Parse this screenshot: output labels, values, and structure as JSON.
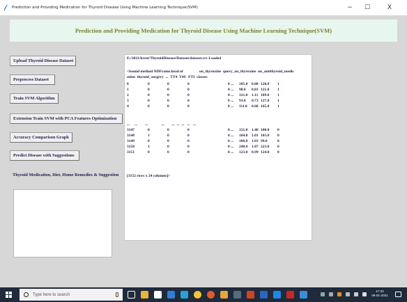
{
  "window": {
    "title": "Prediction and Providing Medication for Thyroid Disease Using Machine Learning Technique(SVM)",
    "minimize": "−",
    "maximize": "☐",
    "close": "X"
  },
  "header": {
    "title": "Prediction and Providing Medication for Thyroid Disease Using Machine Learning Technique(SVM)",
    "colors": {
      "background": "#e7f6ee",
      "text": "#7b7f2c"
    }
  },
  "buttons": [
    {
      "name": "upload-dataset-button",
      "label": "Upload Thyroid Disease Dataset"
    },
    {
      "name": "preprocess-dataset-button",
      "label": "Preprocess Dataset"
    },
    {
      "name": "train-svm-button",
      "label": "Train SVM Algorithm"
    },
    {
      "name": "extension-train-svm-pca-button",
      "label": "Extension Train SVM with PCA Features Optimization"
    },
    {
      "name": "accuracy-comparison-graph-button",
      "label": "Accuracy Comparison Graph"
    },
    {
      "name": "predict-disease-button",
      "label": "Predict Disease with Suggestions"
    },
    {
      "name": "thyroid-medication-button",
      "label": "Thyroid Medication, Diet, Home Remedies & Suggestion"
    }
  ],
  "output": {
    "loaded_message": "E:/2021/kreet/ThyroidDisease/Dataset/dataset.csv Loaded",
    "header_line1": "<bound method NDFrame.head of",
    "header_line1_cols": "on_thyroxine  query_on_thyroxine  on_antithyroid_medic",
    "header_line2": "ation  thyroid_surgery  ...  TT4  T4U  FTI  classes",
    "rows_top": [
      {
        "idx": "0",
        "a": "0",
        "b": "0",
        "c": "0",
        "d": "0 ...",
        "tt4": "105.0",
        "t4u": "0.88",
        "fti": "120.0",
        "cls": "1"
      },
      {
        "idx": "1",
        "a": "0",
        "b": "0",
        "c": "0",
        "d": "0 ...",
        "tt4": "98.0",
        "t4u": "0.81",
        "fti": "121.0",
        "cls": "1"
      },
      {
        "idx": "2",
        "a": "0",
        "b": "0",
        "c": "0",
        "d": "0 ...",
        "tt4": "121.0",
        "t4u": "1.11",
        "fti": "109.0",
        "cls": "1"
      },
      {
        "idx": "3",
        "a": "0",
        "b": "0",
        "c": "0",
        "d": "0 ...",
        "tt4": "93.0",
        "t4u": "0.73",
        "fti": "127.0",
        "cls": "1"
      },
      {
        "idx": "4",
        "a": "0",
        "b": "0",
        "c": "0",
        "d": "0 ...",
        "tt4": "111.0",
        "t4u": "0.68",
        "fti": "165.0",
        "cls": "1"
      }
    ],
    "ellipsis_row": "...     ...        ...              ...        ...  ...  ...   ...   ...",
    "rows_bottom": [
      {
        "idx": "3147",
        "a": "0",
        "b": "0",
        "c": "0",
        "d": "0 ...",
        "tt4": "151.0",
        "t4u": "1.40",
        "fti": "108.0",
        "cls": "0"
      },
      {
        "idx": "3148",
        "a": "1",
        "b": "0",
        "c": "0",
        "d": "0 ...",
        "tt4": "104.0",
        "t4u": "1.01",
        "fti": "103.0",
        "cls": "0"
      },
      {
        "idx": "3149",
        "a": "0",
        "b": "0",
        "c": "0",
        "d": "0 ...",
        "tt4": "106.0",
        "t4u": "1.03",
        "fti": "99.0",
        "cls": "0"
      },
      {
        "idx": "3150",
        "a": "1",
        "b": "0",
        "c": "0",
        "d": "0 ...",
        "tt4": "240.0",
        "t4u": "1.07",
        "fti": "223.0",
        "cls": "0"
      },
      {
        "idx": "3151",
        "a": "0",
        "b": "0",
        "c": "0",
        "d": "0 ...",
        "tt4": "123.0",
        "t4u": "0.99",
        "fti": "124.0",
        "cls": "0"
      }
    ],
    "shape_line": "[3152 rows x 24 columns]>"
  },
  "taskbar": {
    "search_placeholder": "Type here to search",
    "time": "17:22",
    "date": "06-01-2021",
    "icons": [
      "windows-start-icon",
      "search-icon",
      "microphone-icon",
      "task-view-icon",
      "file-explorer-icon",
      "store-icon",
      "mail-icon",
      "edge-icon",
      "chrome-icon",
      "firefox-icon",
      "app-icon",
      "powerpoint-icon",
      "word-icon",
      "photos-icon",
      "settings-icon",
      "notification-icon"
    ]
  }
}
